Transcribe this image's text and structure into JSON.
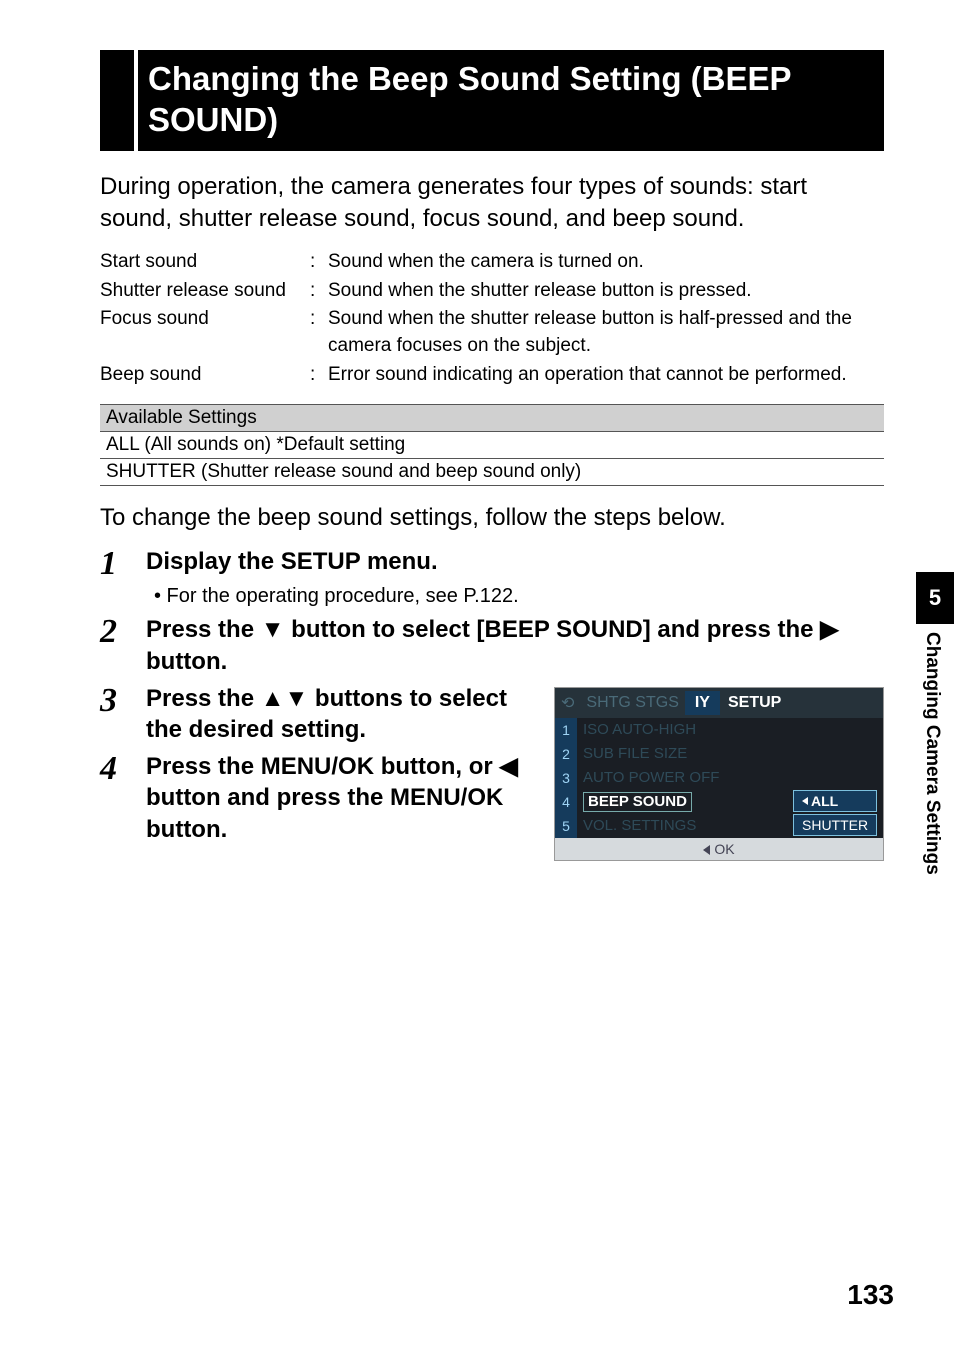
{
  "title": "Changing the Beep Sound Setting (BEEP SOUND)",
  "intro": "During operation, the camera generates four types of sounds: start sound, shutter release sound, focus sound, and beep sound.",
  "defs": [
    {
      "label": "Start sound",
      "val": "Sound when the camera is turned on."
    },
    {
      "label": "Shutter release sound",
      "val": "Sound when the shutter release button is pressed."
    },
    {
      "label": "Focus sound",
      "val": "Sound when the shutter release button is half-pressed and the camera focuses on the subject."
    },
    {
      "label": "Beep sound",
      "val": "Error sound indicating an operation that cannot be performed."
    }
  ],
  "settings": {
    "header": "Available Settings",
    "rows": [
      "ALL (All sounds on) *Default setting",
      "SHUTTER (Shutter release sound and beep sound only)"
    ]
  },
  "intro2": "To change the beep sound settings, follow the steps below.",
  "steps": {
    "s1": {
      "num": "1",
      "head": "Display the SETUP menu.",
      "sub": "• For the operating procedure, see P.122."
    },
    "s2": {
      "num": "2",
      "head_pre": "Press the ",
      "head_mid": " button to select [BEEP SOUND] and press the ",
      "head_post": " button."
    },
    "s3": {
      "num": "3",
      "head_pre": "Press the ",
      "head_post": " buttons to select the desired setting."
    },
    "s4": {
      "num": "4",
      "head_pre": "Press the MENU/OK button, or ",
      "head_post": " button and press the MENU/OK button."
    }
  },
  "screenshot": {
    "tab_dim1": "SHTG STGS",
    "tab_icon": "IY",
    "tab_setup": "SETUP",
    "nums": [
      "1",
      "2",
      "3",
      "4",
      "5"
    ],
    "items": [
      "ISO AUTO-HIGH",
      "SUB FILE SIZE",
      "AUTO POWER OFF",
      "BEEP SOUND",
      "VOL. SETTINGS"
    ],
    "options": [
      "ALL",
      "SHUTTER"
    ],
    "footer": "OK"
  },
  "side": {
    "num": "5",
    "label": "Changing Camera Settings"
  },
  "page_num": "133"
}
